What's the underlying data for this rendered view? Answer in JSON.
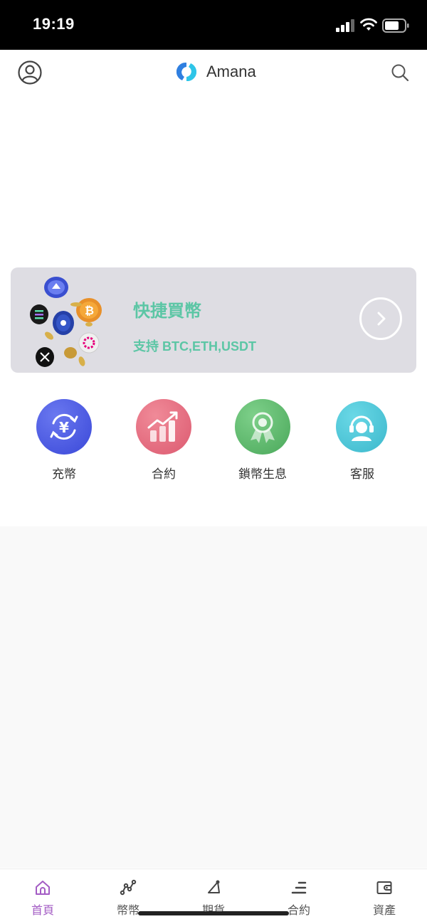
{
  "status_bar": {
    "time": "19:19"
  },
  "header": {
    "app_name": "Amana"
  },
  "quick_buy": {
    "title": "快捷買幣",
    "subtitle": "支持 BTC,ETH,USDT"
  },
  "shortcuts": [
    {
      "label": "充幣",
      "icon": "yen-exchange-icon",
      "color": "#4a5ae0"
    },
    {
      "label": "合約",
      "icon": "growth-chart-icon",
      "color": "#e26a7e"
    },
    {
      "label": "鎖幣生息",
      "icon": "award-badge-icon",
      "color": "#5bb56a"
    },
    {
      "label": "客服",
      "icon": "headset-support-icon",
      "color": "#49c6d8"
    }
  ],
  "tabs": [
    {
      "label": "首頁",
      "icon": "home-icon",
      "active": true
    },
    {
      "label": "幣幣",
      "icon": "trend-nodes-icon",
      "active": false
    },
    {
      "label": "期貨",
      "icon": "triangle-nodes-icon",
      "active": false
    },
    {
      "label": "合約",
      "icon": "stacked-lines-icon",
      "active": false
    },
    {
      "label": "資產",
      "icon": "wallet-icon",
      "active": false
    }
  ],
  "colors": {
    "accent_green": "#5cc6a5",
    "active_tab": "#a35cc4",
    "card_bg": "#dedde3"
  }
}
